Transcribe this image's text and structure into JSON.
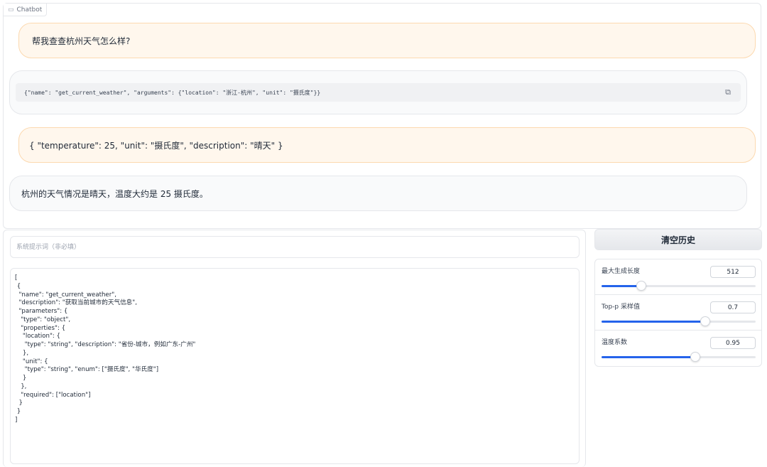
{
  "chatbot": {
    "label": "Chatbot",
    "label_icon": "chat-icon",
    "messages": [
      {
        "role": "user",
        "text": "帮我查查杭州天气怎么样?"
      },
      {
        "role": "assistant",
        "code": "{\"name\": \"get_current_weather\", \"arguments\": {\"location\": \"浙江-杭州\", \"unit\": \"摄氏度\"}}",
        "copy_icon": "copy-icon"
      },
      {
        "role": "user",
        "text": "{ \"temperature\": 25, \"unit\": \"摄氏度\", \"description\": \"晴天\" }"
      },
      {
        "role": "assistant",
        "text": "杭州的天气情况是晴天，温度大约是 25 摄氏度。"
      }
    ]
  },
  "system_prompt": {
    "placeholder": "系统提示词（非必填）",
    "value": ""
  },
  "tools": {
    "value": "[\n {\n  \"name\": \"get_current_weather\",\n  \"description\": \"获取当前城市的天气信息\",\n  \"parameters\": {\n   \"type\": \"object\",\n   \"properties\": {\n    \"location\": {\n     \"type\": \"string\", \"description\": \"省份-城市，例如广东-广州\"\n    },\n    \"unit\": {\n     \"type\": \"string\", \"enum\": [\"摄氏度\", \"华氏度\"]\n    }\n   },\n   \"required\": [\"location\"]\n  }\n }\n]"
  },
  "controls": {
    "clear_label": "清空历史",
    "max_length": {
      "label": "最大生成长度",
      "value": "512",
      "fraction": 0.26
    },
    "top_p": {
      "label": "Top-p 采样值",
      "value": "0.7",
      "fraction": 0.675
    },
    "temperature": {
      "label": "温度系数",
      "value": "0.95",
      "fraction": 0.61
    }
  },
  "colors": {
    "accent": "#2563eb",
    "user_bubble": "#fff7ed",
    "bot_bubble": "#f9fafb"
  }
}
